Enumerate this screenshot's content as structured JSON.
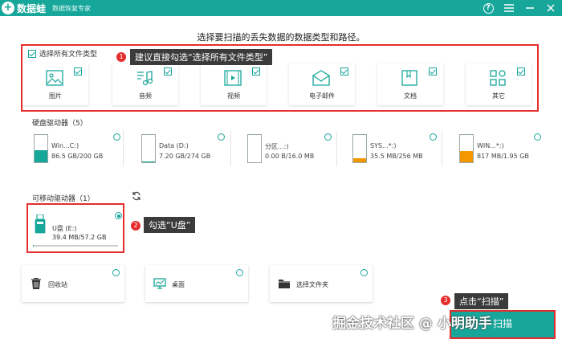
{
  "app": {
    "logo_mark": "+",
    "name": "数据蛙",
    "subtitle": "数据恢复专家",
    "brand_color": "#17a69a"
  },
  "heading": "选择要扫描的丢失数据的数据类型和路径。",
  "file_types": {
    "select_all_label": "选择所有文件类型",
    "select_all_checked": true,
    "items": [
      {
        "label": "图片",
        "icon": "image-icon",
        "checked": true
      },
      {
        "label": "音频",
        "icon": "music-icon",
        "checked": true
      },
      {
        "label": "视频",
        "icon": "video-icon",
        "checked": true
      },
      {
        "label": "电子邮件",
        "icon": "mail-icon",
        "checked": true
      },
      {
        "label": "文档",
        "icon": "document-icon",
        "checked": true
      },
      {
        "label": "其它",
        "icon": "grid-icon",
        "checked": true
      }
    ]
  },
  "callouts": {
    "c1_num": "1",
    "c1_text": "建议直接勾选“选择所有文件类型”",
    "c2_num": "2",
    "c2_text": "勾选“U盘”",
    "c3_num": "3",
    "c3_text": "点击“扫描”"
  },
  "hard_drives": {
    "title": "硬盘驱动器（5）",
    "items": [
      {
        "name": "Win...C:)",
        "size": "86.5 GB/200 GB",
        "fill": 0.43,
        "color": "#17a69a"
      },
      {
        "name": "Data (D:)",
        "size": "7.20 GB/274 GB",
        "fill": 0.03,
        "color": "#17a69a"
      },
      {
        "name": "分区...:)",
        "size": "0.00  B/16.0 MB",
        "fill": 0.0,
        "color": "#17a69a"
      },
      {
        "name": "SYS...*:)",
        "size": "35.5 MB/256 MB",
        "fill": 0.14,
        "color": "#f39800"
      },
      {
        "name": "WIN...*:)",
        "size": "817 MB/1.95 GB",
        "fill": 0.42,
        "color": "#f39800"
      }
    ]
  },
  "removable": {
    "title": "可移动驱动器（1）",
    "usb_name": "U盘 (E:)",
    "usb_size": "39.4 MB/57.2 GB",
    "usb_fill": 0.01,
    "selected": true
  },
  "locations": [
    {
      "label": "回收站",
      "icon": "trash-icon"
    },
    {
      "label": "桌面",
      "icon": "desktop-icon"
    },
    {
      "label": "选择文件夹",
      "icon": "folder-icon"
    }
  ],
  "scan_button_label": "扫描",
  "watermark": "掘金技术社区 @ 小明助手"
}
